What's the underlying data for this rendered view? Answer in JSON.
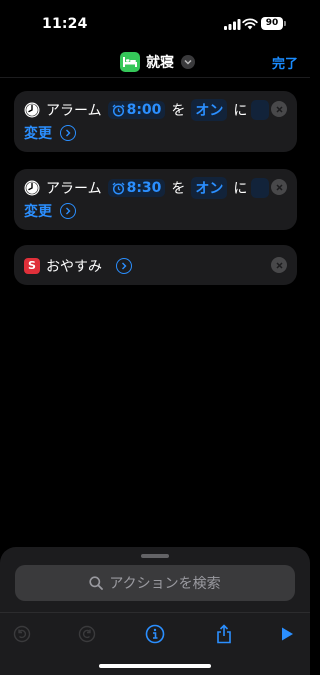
{
  "status": {
    "time": "11:24",
    "battery": "90"
  },
  "nav": {
    "title": "就寝",
    "done_label": "完了"
  },
  "actions": [
    {
      "label": "アラーム",
      "time": "8:00",
      "particle1": "を",
      "state": "オン",
      "particle2": "に",
      "change_label": "変更"
    },
    {
      "label": "アラーム",
      "time": "8:30",
      "particle1": "を",
      "state": "オン",
      "particle2": "に",
      "change_label": "変更"
    },
    {
      "label": "おやすみ",
      "app_letter": "S"
    }
  ],
  "sheet": {
    "search_placeholder": "アクションを検索"
  },
  "colors": {
    "accent": "#2b8fff",
    "card": "#1c1c1e",
    "app_green": "#35c759",
    "shortcut_red": "#e0303a"
  },
  "icons": [
    "bed-icon",
    "chevron-down-icon",
    "clock-icon",
    "alarm-icon",
    "chevron-right-icon",
    "close-icon",
    "search-icon",
    "undo-icon",
    "redo-icon",
    "info-icon",
    "share-icon",
    "play-icon"
  ]
}
